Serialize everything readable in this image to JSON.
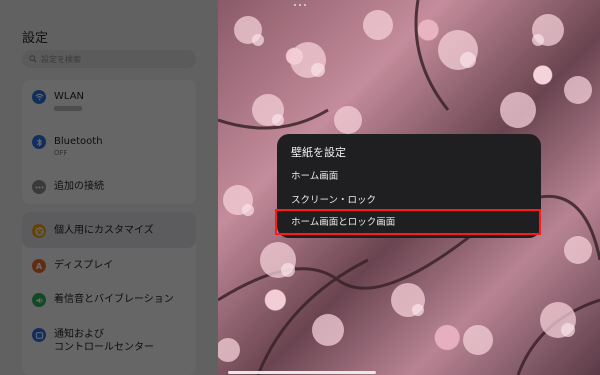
{
  "settings": {
    "title": "設定",
    "search_placeholder": "設定を検索",
    "items": [
      {
        "label": "WLAN",
        "sub": "",
        "icon": "wifi-icon",
        "color": "#2f6fe0"
      },
      {
        "label": "Bluetooth",
        "sub": "OFF",
        "icon": "bluetooth-icon",
        "color": "#2f6fe0"
      },
      {
        "label": "追加の接続",
        "sub": "",
        "icon": "more-dots-icon",
        "color": "#8a8a8e"
      },
      {
        "label": "個人用にカスタマイズ",
        "sub": "",
        "icon": "palette-icon",
        "color": "#e8a21c"
      },
      {
        "label": "ディスプレイ",
        "sub": "",
        "icon": "display-icon",
        "color": "#e66a2c"
      },
      {
        "label": "着信音とバイブレーション",
        "sub": "",
        "icon": "sound-icon",
        "color": "#2fae5a"
      },
      {
        "label": "通知および",
        "label2": "コントロールセンター",
        "sub": "",
        "icon": "notification-icon",
        "color": "#2f6fe0"
      }
    ]
  },
  "menu": {
    "title": "壁紙を設定",
    "items": [
      "ホーム画面",
      "スクリーン・ロック",
      "ホーム画面とロック画面"
    ]
  },
  "colors": {
    "highlight": "#ff1a1a",
    "menu_bg": "#1f1f22"
  }
}
